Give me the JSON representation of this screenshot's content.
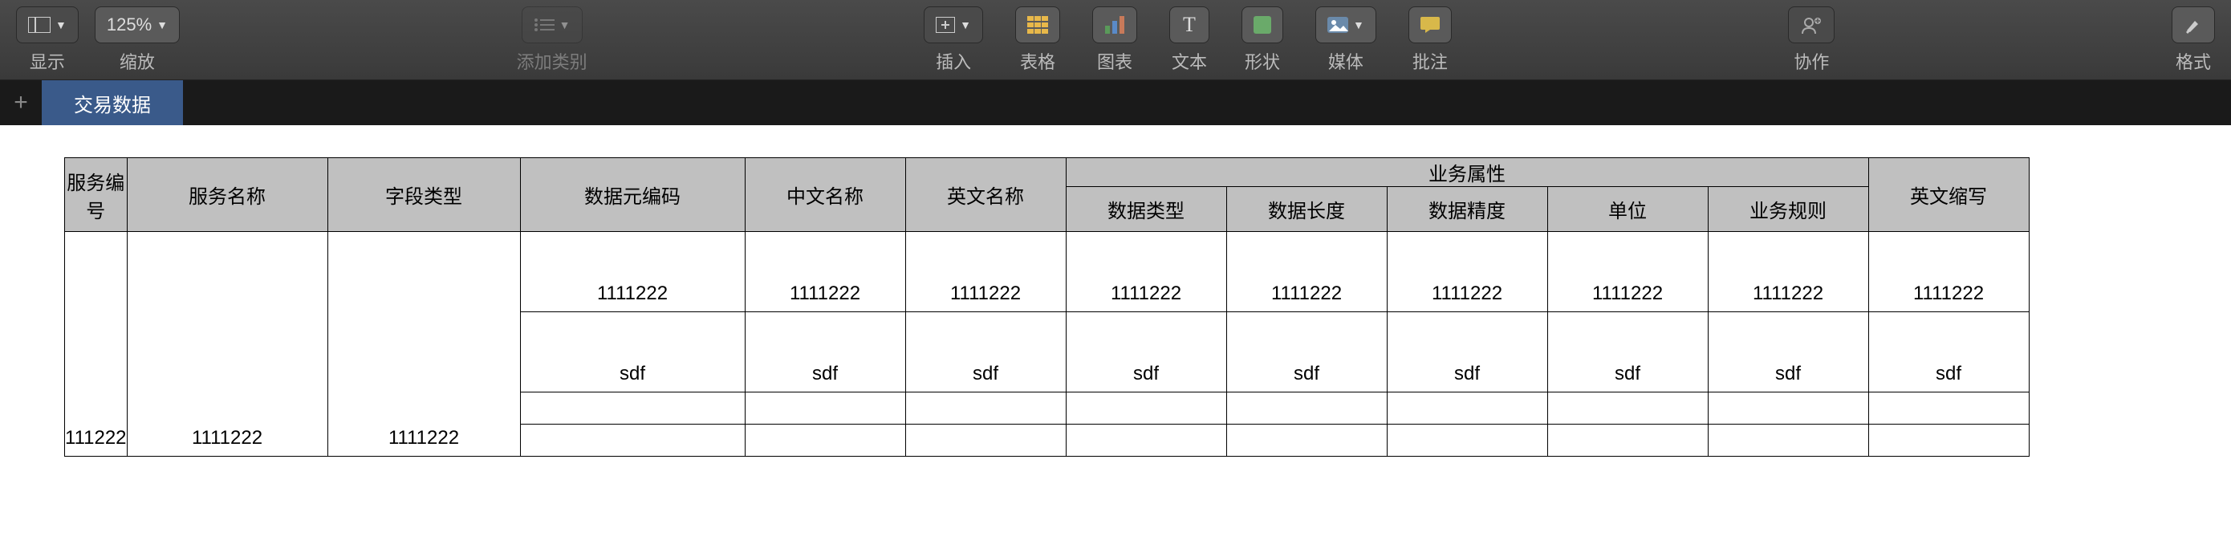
{
  "toolbar": {
    "view_label": "显示",
    "zoom_value": "125%",
    "zoom_label": "缩放",
    "add_category_label": "添加类别",
    "insert_label": "插入",
    "table_label": "表格",
    "chart_label": "图表",
    "text_label": "文本",
    "shape_label": "形状",
    "media_label": "媒体",
    "comment_label": "批注",
    "collab_label": "协作",
    "format_label": "格式"
  },
  "tabs": {
    "active": "交易数据"
  },
  "table": {
    "headers": {
      "c0": "服务编号",
      "c1": "服务名称",
      "c2": "字段类型",
      "c3": "数据元编码",
      "c4": "中文名称",
      "c5": "英文名称",
      "group": "业务属性",
      "c6": "数据类型",
      "c7": "数据长度",
      "c8": "数据精度",
      "c9": "单位",
      "c10": "业务规则",
      "c11": "英文缩写"
    },
    "rows": [
      {
        "c0": "111222",
        "c1": "1111222",
        "c2": "1111222",
        "c3": "1111222",
        "c4": "1111222",
        "c5": "1111222",
        "c6": "1111222",
        "c7": "1111222",
        "c8": "1111222",
        "c9": "1111222",
        "c10": "1111222",
        "c11": "1111222"
      },
      {
        "c3": "sdf",
        "c4": "sdf",
        "c5": "sdf",
        "c6": "sdf",
        "c7": "sdf",
        "c8": "sdf",
        "c9": "sdf",
        "c10": "sdf",
        "c11": "sdf"
      },
      {},
      {}
    ]
  }
}
